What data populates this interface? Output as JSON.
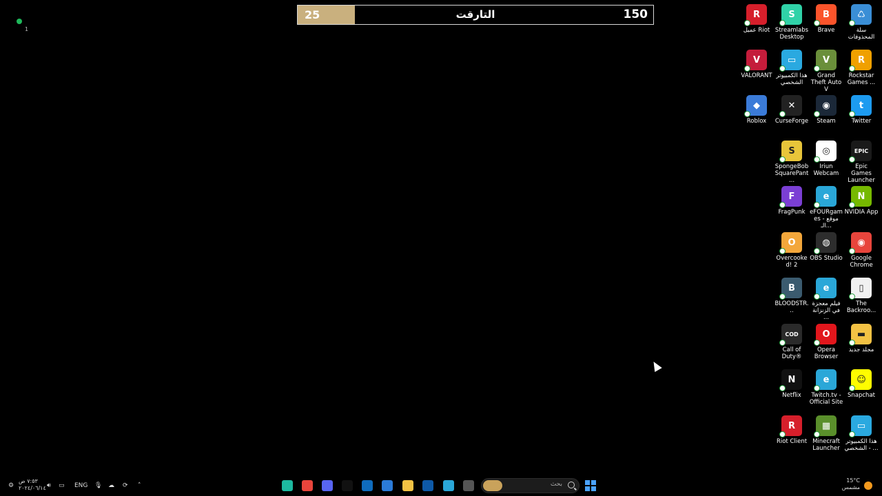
{
  "target_bar": {
    "current": "25",
    "goal": "150",
    "title": "التارقت",
    "progress": 0.16,
    "fill_color": "#c9b07e"
  },
  "top_left_widget": {
    "count": "1",
    "status_color": "#1eb85a"
  },
  "desktop_icons": [
    {
      "label": "عميل Riot",
      "color": "#d61f2b",
      "glyph": "R",
      "icon": "riot-client-icon"
    },
    {
      "label": "Streamlabs Desktop",
      "color": "#30d2a8",
      "glyph": "S",
      "icon": "streamlabs-icon"
    },
    {
      "label": "Brave",
      "color": "#fb542b",
      "glyph": "B",
      "icon": "brave-icon"
    },
    {
      "label": "سلة المحذوفات",
      "color": "#3a8ed6",
      "glyph": "♺",
      "icon": "recycle-bin-icon"
    },
    {
      "label": "VALORANT",
      "color": "#c41c3b",
      "glyph": "V",
      "icon": "valorant-icon"
    },
    {
      "label": "هذا الكمبيوتر الشخصي",
      "color": "#2aa9e0",
      "glyph": "▭",
      "icon": "this-pc-icon"
    },
    {
      "label": "Grand Theft Auto V",
      "color": "#6a8f3a",
      "glyph": "V",
      "icon": "gta-v-icon"
    },
    {
      "label": "Rockstar Games ...",
      "color": "#f0a000",
      "glyph": "R",
      "icon": "rockstar-icon"
    },
    {
      "label": "Roblox",
      "color": "#3b7bd8",
      "glyph": "◆",
      "icon": "roblox-icon"
    },
    {
      "label": "CurseForge",
      "color": "#222222",
      "glyph": "✕",
      "icon": "curseforge-icon"
    },
    {
      "label": "Steam",
      "color": "#1b2838",
      "glyph": "◉",
      "icon": "steam-icon"
    },
    {
      "label": "Twitter",
      "color": "#1d9bf0",
      "glyph": "t",
      "icon": "twitter-icon"
    },
    {
      "label": "SpongeBob SquarePant...",
      "color": "#e8c53a",
      "glyph": "S",
      "icon": "spongebob-icon"
    },
    {
      "label": "Iriun Webcam",
      "color": "#ffffff",
      "glyph": "◎",
      "icon": "iriun-webcam-icon"
    },
    {
      "label": "Epic Games Launcher",
      "color": "#1a1a1a",
      "glyph": "EPIC",
      "icon": "epic-games-icon"
    },
    {
      "label": "FragPunk",
      "color": "#7b3fd4",
      "glyph": "F",
      "icon": "fragpunk-icon"
    },
    {
      "label": "eFOURgames - موقع الـ...",
      "color": "#2aa7d8",
      "glyph": "e",
      "icon": "edge-site-icon"
    },
    {
      "label": "NVIDIA App",
      "color": "#76b900",
      "glyph": "N",
      "icon": "nvidia-icon"
    },
    {
      "label": "Overcooked! 2",
      "color": "#f3a73b",
      "glyph": "O",
      "icon": "overcooked-icon"
    },
    {
      "label": "OBS Studio",
      "color": "#2d2d2d",
      "glyph": "◍",
      "icon": "obs-icon"
    },
    {
      "label": "Google Chrome",
      "color": "#e8453c",
      "glyph": "◉",
      "icon": "chrome-icon"
    },
    {
      "label": "BLOODSTR...",
      "color": "#3b5b6f",
      "glyph": "B",
      "icon": "bloodstrike-icon"
    },
    {
      "label": "فيلم معجزة في الزنزانة ...",
      "color": "#2aa7d8",
      "glyph": "e",
      "icon": "edge-site-icon"
    },
    {
      "label": "The Backroo...",
      "color": "#f1f1f1",
      "glyph": "▯",
      "icon": "file-icon"
    },
    {
      "label": "Call of Duty®",
      "color": "#2a2a2a",
      "glyph": "COD",
      "icon": "call-of-duty-icon"
    },
    {
      "label": "Opera Browser",
      "color": "#e2161c",
      "glyph": "O",
      "icon": "opera-icon"
    },
    {
      "label": "مجلد جديد",
      "color": "#f3c244",
      "glyph": "▬",
      "icon": "folder-icon"
    },
    {
      "label": "Netflix",
      "color": "#111111",
      "glyph": "N",
      "icon": "netflix-icon"
    },
    {
      "label": "Twitch.tv - Official Site",
      "color": "#2aa7d8",
      "glyph": "e",
      "icon": "edge-site-icon"
    },
    {
      "label": "Snapchat",
      "color": "#fffc00",
      "glyph": "☺",
      "icon": "snapchat-icon"
    },
    {
      "label": "Riot Client",
      "color": "#d61f2b",
      "glyph": "R",
      "icon": "riot-client-icon"
    },
    {
      "label": "Minecraft Launcher",
      "color": "#5a8f2b",
      "glyph": "▦",
      "icon": "minecraft-icon"
    },
    {
      "label": "هذا الكمبيوتر - الشخصي ...",
      "color": "#2aa9e0",
      "glyph": "▭",
      "icon": "this-pc-icon"
    }
  ],
  "taskbar": {
    "clock_time": "٧:٥٣ ص",
    "clock_date": "٢٠٢٤/٠٦/١٤",
    "language": "ENG",
    "search_placeholder": "بحث",
    "weather_temp": "15°C",
    "weather_desc": "مشمس",
    "apps": [
      {
        "icon": "gallery-icon",
        "color": "#1db9a0"
      },
      {
        "icon": "chrome-icon",
        "color": "#e8453c"
      },
      {
        "icon": "discord-icon",
        "color": "#5865f2"
      },
      {
        "icon": "tiktok-icon",
        "color": "#111111"
      },
      {
        "icon": "outlook-icon",
        "color": "#0f6cbd"
      },
      {
        "icon": "store-icon",
        "color": "#2b7bd8"
      },
      {
        "icon": "file-explorer-icon",
        "color": "#f3c244"
      },
      {
        "icon": "task-view-icon",
        "color": "#0e5aa8"
      },
      {
        "icon": "edge-icon",
        "color": "#2aa7d8"
      },
      {
        "icon": "window-icon",
        "color": "#555555"
      }
    ]
  }
}
